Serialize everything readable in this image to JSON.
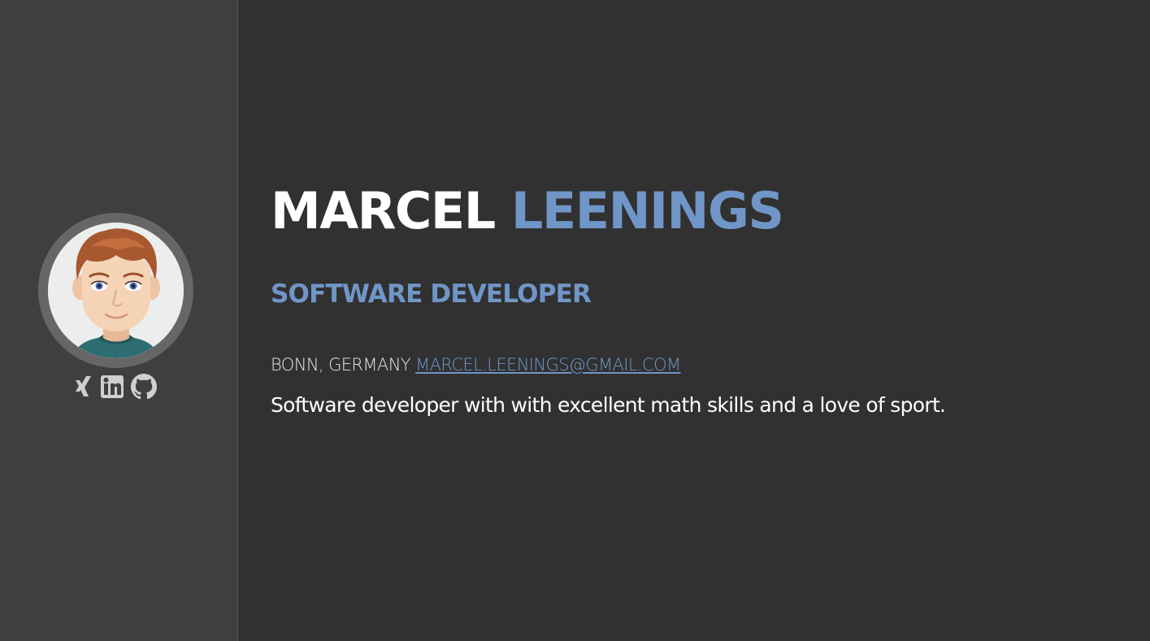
{
  "profile": {
    "first_name": "MARCEL",
    "last_name": "LEENINGS",
    "title": "SOFTWARE DEVELOPER",
    "location": "BONN, GERMANY",
    "email": "MARCEL.LEENINGS@GMAIL.COM",
    "summary": "Software developer with with excellent math skills and a love of sport."
  },
  "social": {
    "icons": [
      "xing-icon",
      "linkedin-icon",
      "github-icon"
    ]
  },
  "colors": {
    "background": "#313131",
    "sidebar": "#3f3f3f",
    "accent": "#7096c8",
    "text": "#ffffff",
    "icon": "#cfcfcf"
  }
}
